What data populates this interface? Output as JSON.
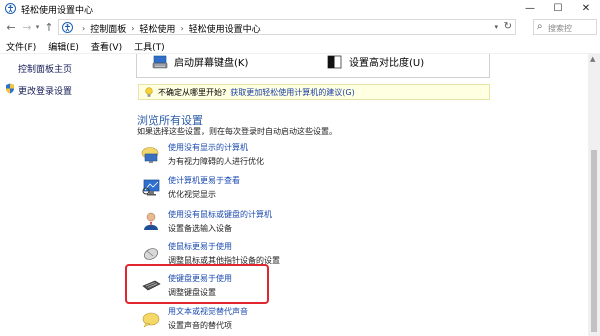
{
  "window": {
    "title": "轻松使用设置中心",
    "min_glyph": "—",
    "max_glyph": "☐",
    "close_glyph": "✕"
  },
  "address": {
    "breadcrumbs": [
      "控制面板",
      "轻松使用",
      "轻松使用设置中心"
    ],
    "separator": "›",
    "search_placeholder": "搜索控"
  },
  "menu": {
    "items": [
      "文件(F)",
      "编辑(E)",
      "查看(V)",
      "工具(T)"
    ]
  },
  "sidebar": {
    "home_label": "控制面板主页",
    "signin_label": "更改登录设置"
  },
  "quick": {
    "keyboard_label": "启动屏幕键盘(K)",
    "contrast_label": "设置高对比度(U)"
  },
  "tip": {
    "question": "不确定从哪里开始?",
    "link": "获取更加轻松使用计算机的建议(G)"
  },
  "section": {
    "title": "浏览所有设置",
    "desc": "如果选择这些设置，则在每次登录时自动启动这些设置。"
  },
  "items": [
    {
      "link": "使用没有显示的计算机",
      "sub": "为有视力障碍的人进行优化",
      "icon": "monitor-off-icon"
    },
    {
      "link": "使计算机更易于查看",
      "sub": "优化视觉显示",
      "icon": "monitor-icon"
    },
    {
      "link": "使用没有鼠标或键盘的计算机",
      "sub": "设置备选输入设备",
      "icon": "person-icon"
    },
    {
      "link": "使鼠标更易于使用",
      "sub": "调整鼠标或其他指针设备的设置",
      "icon": "mouse-icon"
    },
    {
      "link": "使键盘更易于使用",
      "sub": "调整键盘设置",
      "icon": "keyboard-icon"
    },
    {
      "link": "用文本或视觉替代声音",
      "sub": "设置声音的替代项",
      "icon": "speech-icon"
    }
  ],
  "colors": {
    "link": "#1a4ab0",
    "highlight": "#e0262e",
    "tip_bg": "#ffffe1"
  }
}
